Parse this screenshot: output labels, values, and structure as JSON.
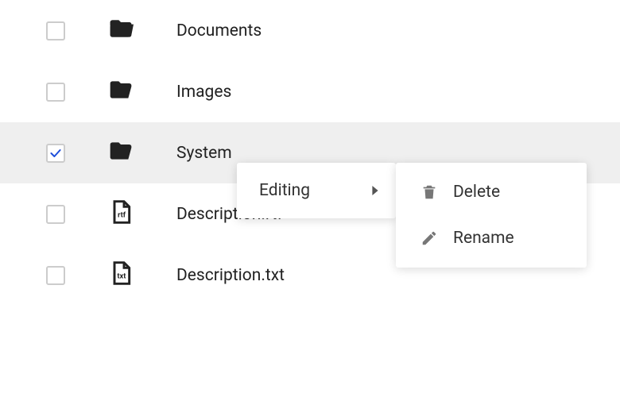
{
  "rows": [
    {
      "name": "Documents",
      "type": "folder",
      "checked": false
    },
    {
      "name": "Images",
      "type": "folder",
      "checked": false
    },
    {
      "name": "System",
      "type": "folder",
      "checked": true
    },
    {
      "name": "Description.rtf",
      "type": "rtf",
      "checked": false
    },
    {
      "name": "Description.txt",
      "type": "txt",
      "checked": false
    }
  ],
  "menu": {
    "primary": {
      "editing": "Editing"
    },
    "secondary": {
      "delete": "Delete",
      "rename": "Rename"
    }
  }
}
